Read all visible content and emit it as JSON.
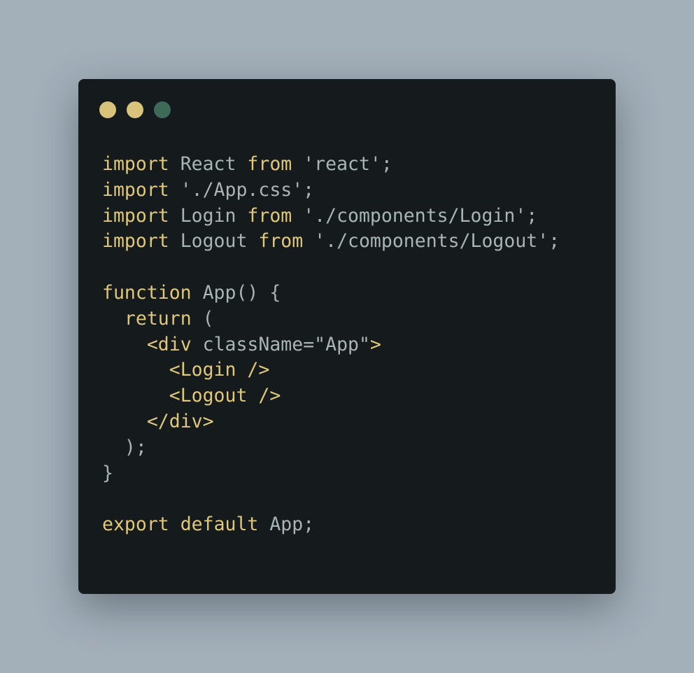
{
  "window": {
    "controls": [
      {
        "name": "close",
        "color": "#d9c27a"
      },
      {
        "name": "minimize",
        "color": "#d9c27a"
      },
      {
        "name": "maximize",
        "color": "#3d6b57"
      }
    ]
  },
  "colors": {
    "background": "#a3afb9",
    "panel": "#151a1c",
    "keyword": "#e0c77a",
    "text": "#a8b4b6"
  },
  "code": {
    "l1": {
      "kw1": "import",
      "t1": " React ",
      "kw2": "from",
      "t2": " 'react';"
    },
    "l2": {
      "kw1": "import",
      "t1": " './App.css';"
    },
    "l3": {
      "kw1": "import",
      "t1": " Login ",
      "kw2": "from",
      "t2": " './components/Login';"
    },
    "l4": {
      "kw1": "import",
      "t1": " Logout ",
      "kw2": "from",
      "t2": " './components/Logout';"
    },
    "l6": {
      "kw1": "function",
      "t1": " App() {"
    },
    "l7": {
      "indent": "  ",
      "kw1": "return",
      "t1": " ("
    },
    "l8": {
      "indent": "    ",
      "tag1": "<div",
      "t1": " className=\"App\"",
      "tag2": ">"
    },
    "l9": {
      "indent": "      ",
      "tag1": "<Login",
      "tag2": " />"
    },
    "l10": {
      "indent": "      ",
      "tag1": "<Logout",
      "tag2": " />"
    },
    "l11": {
      "indent": "    ",
      "tag1": "</div>"
    },
    "l12": {
      "t1": "  );"
    },
    "l13": {
      "t1": "}"
    },
    "l15": {
      "kw1": "export",
      "t1": " ",
      "kw2": "default",
      "t2": " App;"
    }
  }
}
